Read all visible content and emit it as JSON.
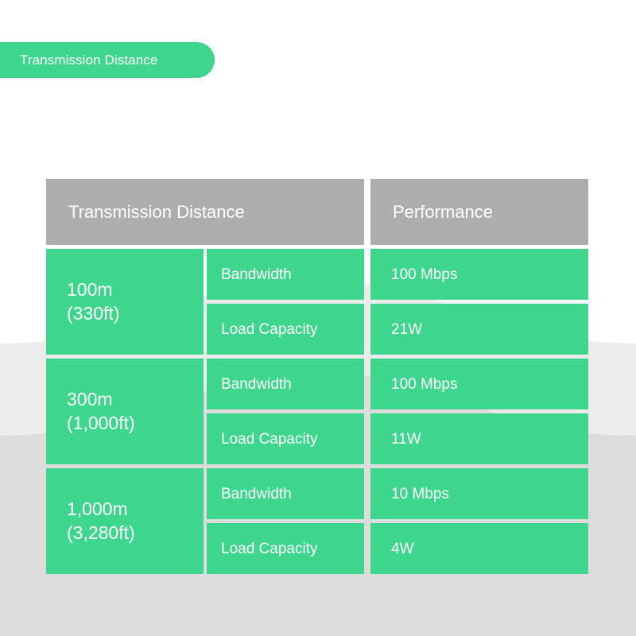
{
  "colors": {
    "green": "#3DD68C",
    "header_gray": "#ADADAD",
    "page_background": "#FFFFFF",
    "arc_light_gray": "#ECECEC",
    "arc_dark_gray": "#DCDCDC",
    "text_on_fill": "#FFFFFF"
  },
  "badge": {
    "label": "Transmission Distance"
  },
  "table": {
    "headers": {
      "distance": "Transmission Distance",
      "performance": "Performance"
    },
    "groups": [
      {
        "distance_line1": "100m",
        "distance_line2": "(330ft)",
        "rows": [
          {
            "metric": "Bandwidth",
            "value": "100 Mbps"
          },
          {
            "metric": "Load Capacity",
            "value": "21W"
          }
        ]
      },
      {
        "distance_line1": "300m",
        "distance_line2": "(1,000ft)",
        "rows": [
          {
            "metric": "Bandwidth",
            "value": "100 Mbps"
          },
          {
            "metric": "Load Capacity",
            "value": "11W"
          }
        ]
      },
      {
        "distance_line1": "1,000m",
        "distance_line2": "(3,280ft)",
        "rows": [
          {
            "metric": "Bandwidth",
            "value": "10 Mbps"
          },
          {
            "metric": "Load Capacity",
            "value": "4W"
          }
        ]
      }
    ]
  }
}
